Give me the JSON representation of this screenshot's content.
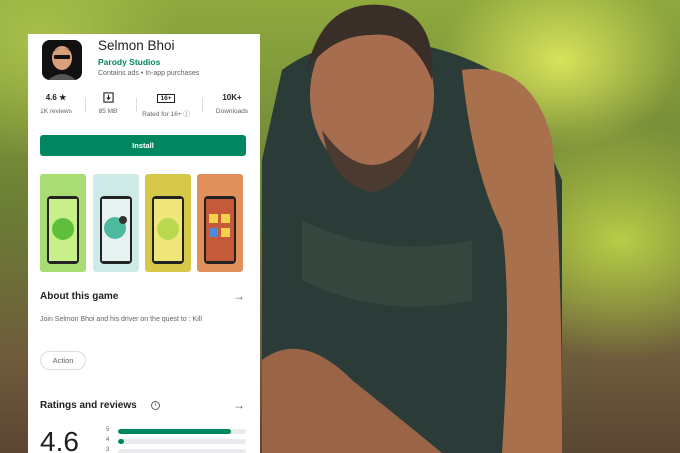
{
  "app": {
    "title": "Selmon Bhoi",
    "developer": "Parody Studios",
    "meta": "Contains ads  •  In-app purchases"
  },
  "stats": [
    {
      "value": "4.6 ★",
      "label": "1K reviews"
    },
    {
      "value": "",
      "label": "85 MB"
    },
    {
      "value": "16+",
      "label": "Rated for 16+ ⓘ"
    },
    {
      "value": "10K+",
      "label": "Downloads"
    }
  ],
  "install_label": "Install",
  "about": {
    "title": "About this game",
    "arrow": "→",
    "description": "Join Selmon Bhoi and his driver on the quest to : Kill",
    "tag": "Action"
  },
  "ratings": {
    "title": "Ratings and reviews",
    "info": "i",
    "arrow": "→",
    "average": "4.6",
    "bars": [
      {
        "label": "5",
        "fraction": 0.88
      },
      {
        "label": "4",
        "fraction": 0.05
      },
      {
        "label": "3",
        "fraction": 0.0
      }
    ]
  },
  "colors": {
    "accent": "#01875f",
    "text": "#202124",
    "muted": "#5f6368"
  }
}
